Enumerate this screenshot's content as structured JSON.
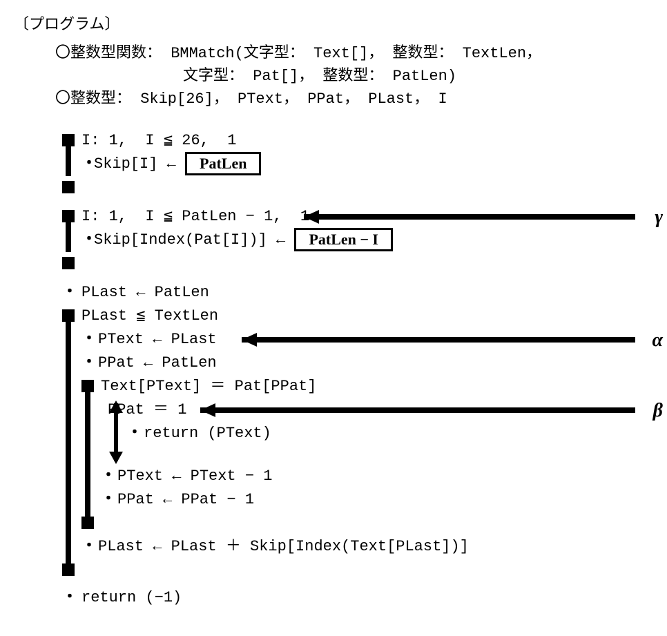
{
  "header": {
    "title": "〔プログラム〕",
    "circle": "〇",
    "decl1": "整数型関数： BMMatch(文字型： Text[]， 整数型： TextLen，",
    "decl1b": "文字型： Pat[]， 整数型： PatLen)",
    "decl2": "整数型： Skip[26]， PText， PPat， PLast， I"
  },
  "code": {
    "l1": "I: 1,  I ≦ 26,  1",
    "l2a": "Skip[I] ← ",
    "box1": "PatLen",
    "l4": "I: 1,  I ≦ PatLen − 1,  1",
    "l5a": "Skip[Index(Pat[I])] ← ",
    "box2": "PatLen − I",
    "l7": "PLast ← PatLen",
    "l8": "PLast ≦ TextLen",
    "l9": "PText ← PLast",
    "l10": "PPat ← PatLen",
    "l11": "Text[PText] ＝ Pat[PPat]",
    "l12": "PPat ＝ 1",
    "l13": "return (PText)",
    "l15": "PText ← PText − 1",
    "l16": "PPat ← PPat − 1",
    "l18": "PLast ← PLast ＋ Skip[Index(Text[PLast])]",
    "l20": "return (−1)"
  },
  "labels": {
    "gamma": "γ",
    "alpha": "α",
    "beta": "β"
  },
  "chart_data": {
    "type": "table",
    "description": "Pseudocode program for BMMatch (Boyer-Moore string matching)",
    "function": "BMMatch",
    "parameters": [
      "Text[] (文字型)",
      "TextLen (整数型)",
      "Pat[] (文字型)",
      "PatLen (整数型)"
    ],
    "locals": [
      "Skip[26]",
      "PText",
      "PPat",
      "PLast",
      "I"
    ],
    "statements": [
      {
        "type": "loop",
        "head": "I: 1, I ≦ 26, 1",
        "body": [
          "Skip[I] ← PatLen"
        ]
      },
      {
        "type": "loop",
        "head": "I: 1, I ≦ PatLen − 1, 1",
        "label": "γ",
        "body": [
          "Skip[Index(Pat[I])] ← PatLen − I"
        ]
      },
      {
        "type": "stmt",
        "text": "PLast ← PatLen"
      },
      {
        "type": "loop",
        "head": "PLast ≦ TextLen",
        "body": [
          {
            "type": "stmt",
            "text": "PText ← PLast",
            "label": "α"
          },
          {
            "type": "stmt",
            "text": "PPat ← PatLen"
          },
          {
            "type": "loop",
            "head": "Text[PText] ＝ Pat[PPat]",
            "body": [
              {
                "type": "branch",
                "head": "PPat ＝ 1",
                "label": "β",
                "true": [
                  "return (PText)"
                ]
              },
              {
                "type": "stmt",
                "text": "PText ← PText − 1"
              },
              {
                "type": "stmt",
                "text": "PPat ← PPat − 1"
              }
            ]
          },
          {
            "type": "stmt",
            "text": "PLast ← PLast ＋ Skip[Index(Text[PLast])]"
          }
        ]
      },
      {
        "type": "stmt",
        "text": "return (−1)"
      }
    ],
    "boxed_answers": [
      "PatLen",
      "PatLen − I"
    ]
  }
}
